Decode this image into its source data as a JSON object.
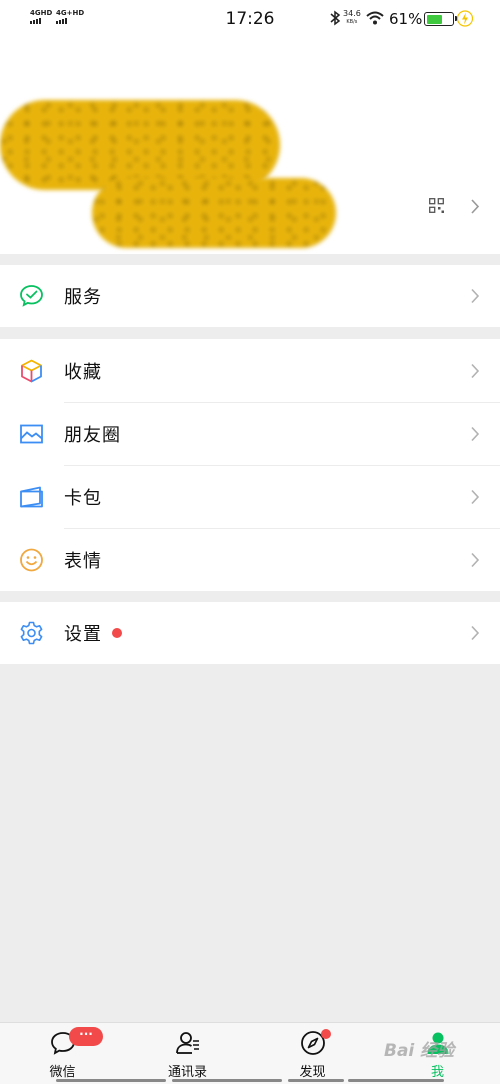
{
  "status_bar": {
    "sim1": "4GHD",
    "sim2": "4G+HD",
    "time": "17:26",
    "net_speed": "34.6",
    "net_speed_unit": "KB/s",
    "battery_text": "61%",
    "battery_level": 0.61
  },
  "menu": {
    "services": "服务",
    "favorites": "收藏",
    "moments": "朋友圈",
    "cards": "卡包",
    "stickers": "表情",
    "settings": "设置"
  },
  "tabbar": {
    "chats_badge": "···",
    "tabs": [
      {
        "label": "微信",
        "icon": "chat-icon"
      },
      {
        "label": "通讯录",
        "icon": "contacts-icon"
      },
      {
        "label": "发现",
        "icon": "compass-icon"
      },
      {
        "label": "我",
        "icon": "me-icon",
        "active": true
      }
    ]
  },
  "watermark": "Bai 经验",
  "colors": {
    "wechat_green": "#07c160",
    "badge_red": "#f24a4a",
    "page_bg": "#ededed"
  }
}
